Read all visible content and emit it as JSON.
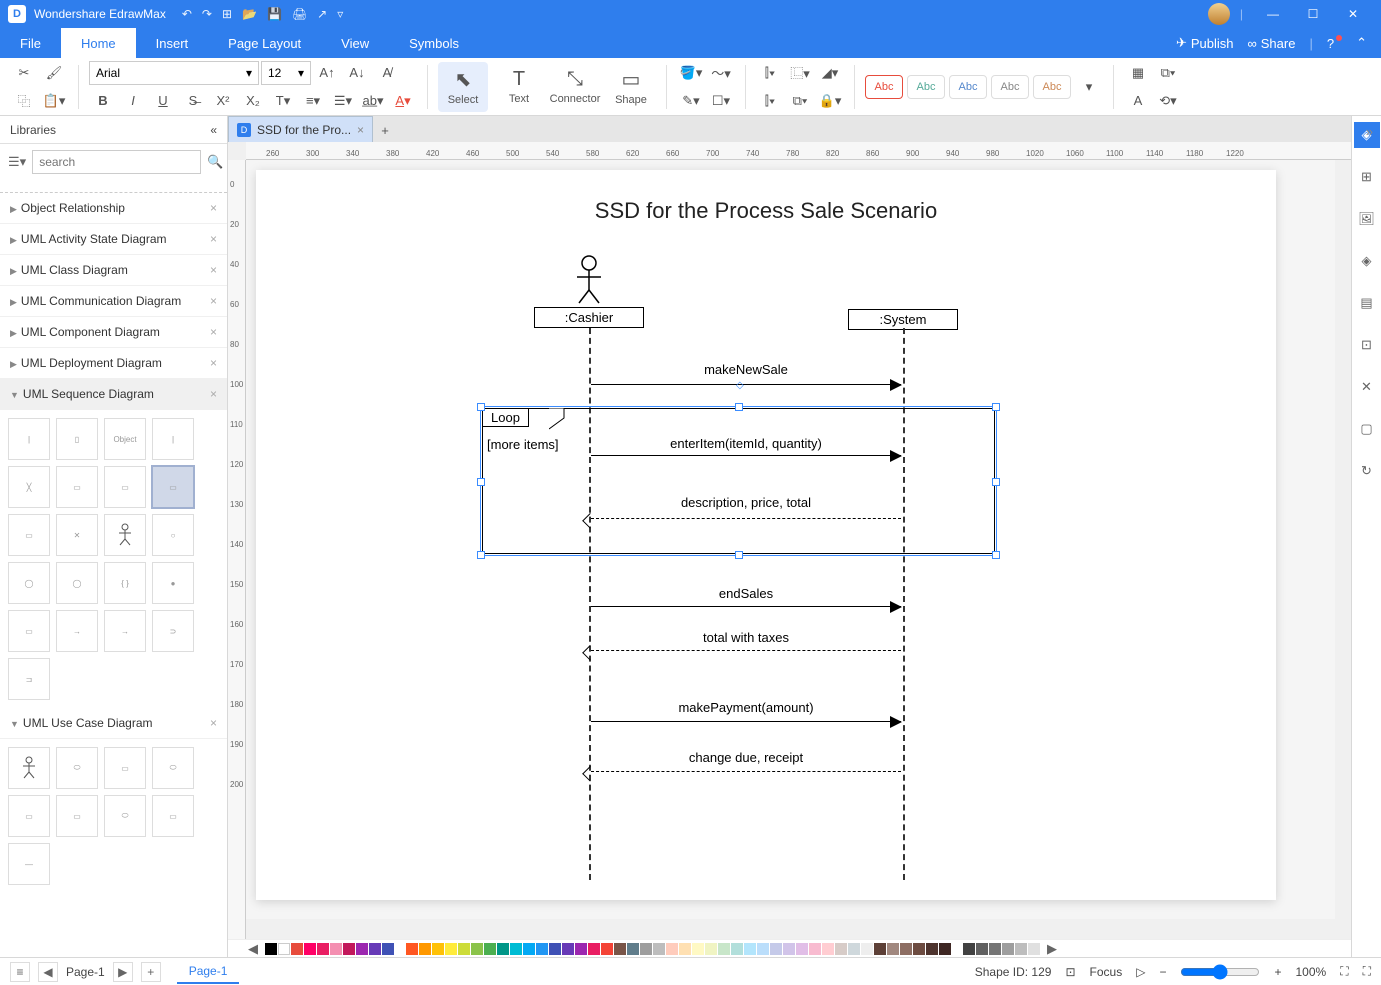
{
  "app": {
    "title": "Wondershare EdrawMax"
  },
  "menubar": {
    "tabs": [
      "File",
      "Home",
      "Insert",
      "Page Layout",
      "View",
      "Symbols"
    ],
    "active": 1,
    "publish": "Publish",
    "share": "Share"
  },
  "ribbon": {
    "font_name": "Arial",
    "font_size": "12",
    "select": "Select",
    "text": "Text",
    "connector": "Connector",
    "shape": "Shape",
    "abc": "Abc"
  },
  "libraries": {
    "title": "Libraries",
    "search_placeholder": "search",
    "categories": [
      "Object Relationship",
      "UML Activity State Diagram",
      "UML Class Diagram",
      "UML Communication Diagram",
      "UML Component Diagram",
      "UML Deployment Diagram",
      "UML Sequence Diagram",
      "UML Use Case Diagram"
    ],
    "open_index": 6
  },
  "doctab": "SSD for the Pro...",
  "diagram": {
    "title": "SSD for the Process Sale Scenario",
    "cashier": ":Cashier",
    "system": ":System",
    "loop_label": "Loop",
    "loop_cond": "[more items]",
    "messages": [
      "makeNewSale",
      "enterItem(itemId, quantity)",
      "description, price, total",
      "endSales",
      "total with taxes",
      "makePayment(amount)",
      "change due, receipt"
    ]
  },
  "statusbar": {
    "page_label": "Page-1",
    "tab_label": "Page-1",
    "shape_id": "Shape ID: 129",
    "focus": "Focus",
    "zoom": "100%"
  },
  "ruler_h": [
    "260",
    "300",
    "340",
    "380",
    "420",
    "460",
    "500",
    "540",
    "580",
    "620",
    "660",
    "700",
    "740",
    "780",
    "820",
    "860",
    "900",
    "940",
    "980",
    "1020",
    "1060",
    "1100",
    "1140",
    "1180",
    "1220"
  ],
  "ruler_v": [
    "0",
    "20",
    "40",
    "60",
    "80",
    "100",
    "110",
    "120",
    "130",
    "140",
    "150",
    "160",
    "170",
    "180",
    "190",
    "200"
  ]
}
